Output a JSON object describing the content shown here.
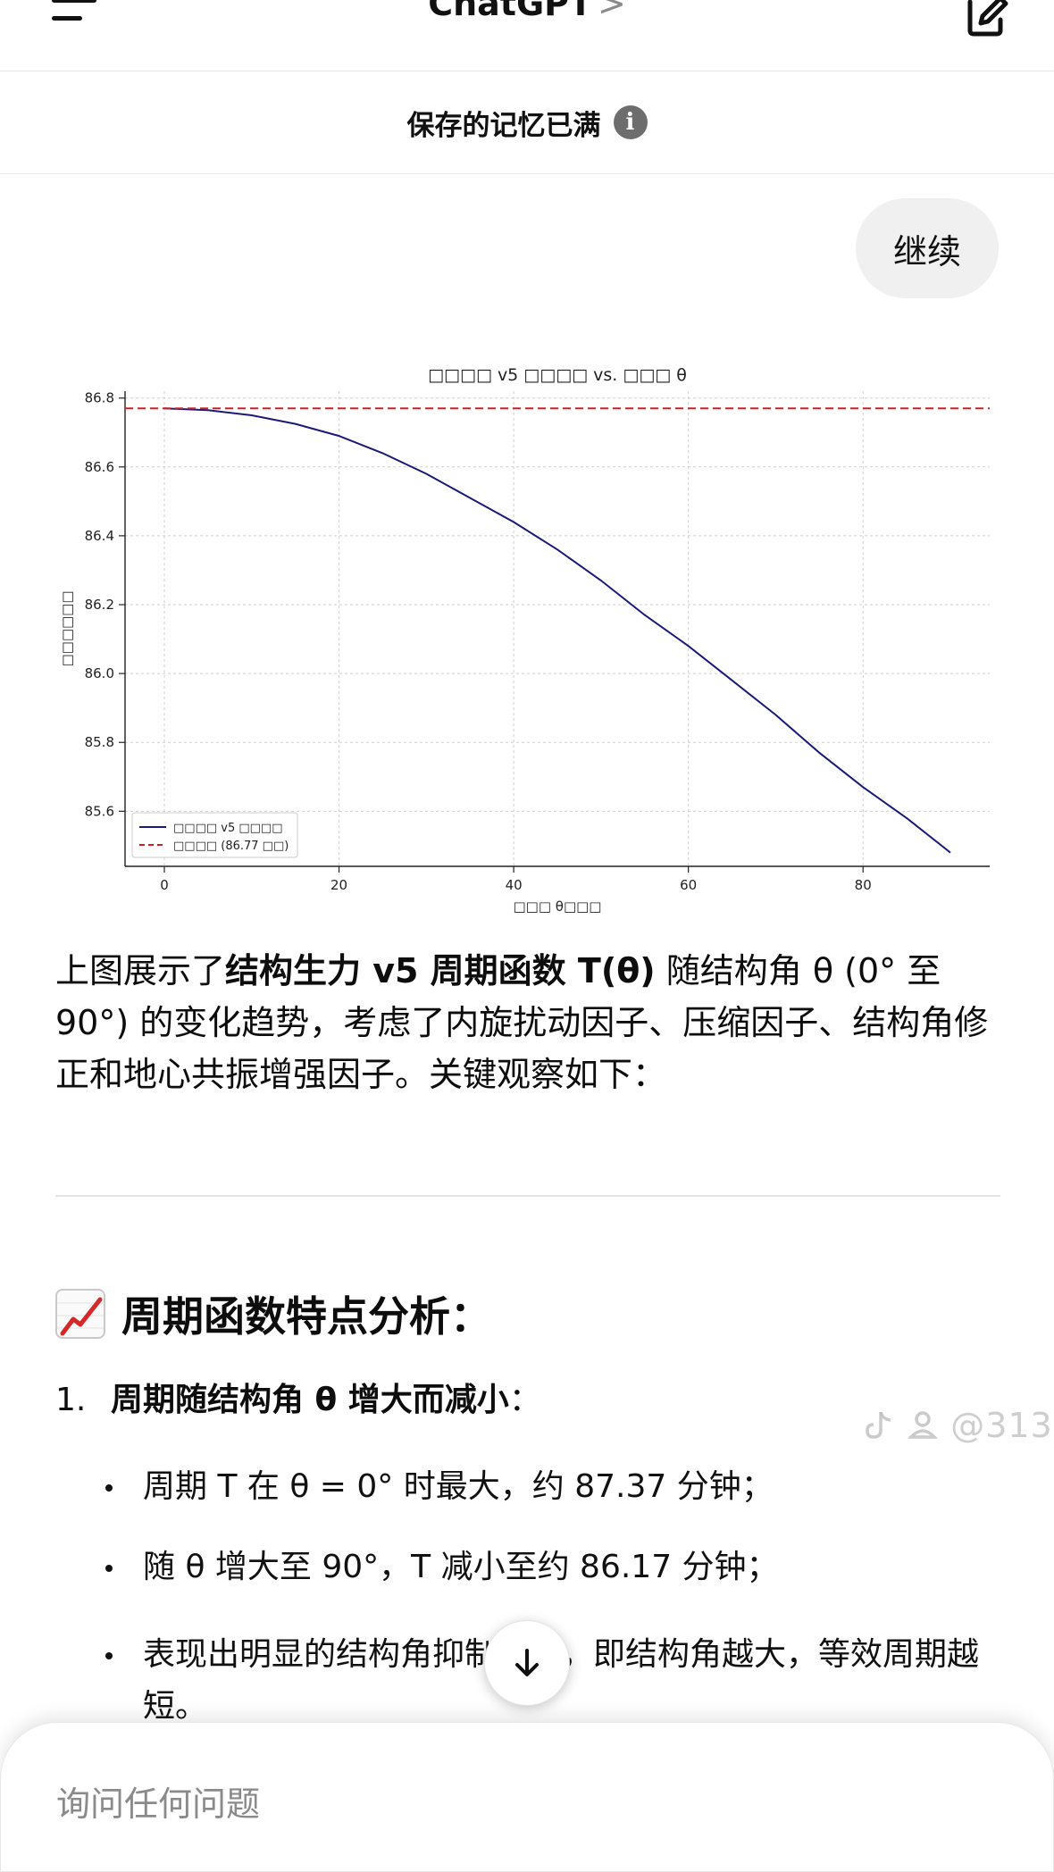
{
  "header": {
    "title": "ChatGPT",
    "title_chevron": ">",
    "menu_icon": "hamburger-icon",
    "compose_icon": "compose-icon"
  },
  "memory_banner": {
    "text": "保存的记忆已满",
    "icon": "info-icon",
    "icon_glyph": "i"
  },
  "user_message": {
    "text": "继续"
  },
  "chart_data": {
    "type": "line",
    "title": "□□□□ v5 □□□□ vs. □□□ θ",
    "xlabel": "□□□ θ□□□",
    "ylabel": "□□□□□□",
    "xlim": [
      -4.5,
      94.5
    ],
    "ylim": [
      85.44,
      86.82
    ],
    "xticks": [
      0,
      20,
      40,
      60,
      80
    ],
    "yticks": [
      85.6,
      85.8,
      86.0,
      86.2,
      86.4,
      86.6,
      86.8
    ],
    "xtick_labels": [
      "0",
      "20",
      "40",
      "60",
      "80"
    ],
    "ytick_labels": [
      "85.6",
      "85.8",
      "86.0",
      "86.2",
      "86.4",
      "86.6",
      "86.8"
    ],
    "grid": true,
    "legend_position": "lower-left",
    "series": [
      {
        "name": "□□□□ v5 □□□□",
        "style": "solid",
        "color": "#1a1a7a",
        "x": [
          0,
          5,
          10,
          15,
          20,
          25,
          30,
          35,
          40,
          45,
          50,
          55,
          60,
          65,
          70,
          75,
          80,
          85,
          90
        ],
        "y": [
          86.77,
          86.765,
          86.75,
          86.725,
          86.69,
          86.64,
          86.58,
          86.51,
          86.44,
          86.36,
          86.27,
          86.17,
          86.08,
          85.98,
          85.88,
          85.77,
          85.67,
          85.58,
          85.48
        ]
      },
      {
        "name": "□□□□ (86.77 □□)",
        "style": "dashed",
        "color": "#cc2222",
        "x": [
          -4.5,
          94.5
        ],
        "y": [
          86.77,
          86.77
        ]
      }
    ]
  },
  "summary": {
    "p1": "上图展示了",
    "bold1": "结构生力 v5 周期函数 T(θ)",
    "p2": " 随结构角 θ (0° 至 90°) 的变化趋势，考虑了内旋扰动因子、压缩因子、结构角修正和地心共振增强因子。关键观察如下："
  },
  "section": {
    "title": "周期函数特点分析：",
    "icon": "chart-increasing-icon"
  },
  "list": {
    "item1_num": "1.",
    "item1_bold": "周期随结构角 θ 增大而减小",
    "item1_tail": "：",
    "bullets": [
      "周期 T 在 θ = 0° 时最大，约 87.37 分钟；",
      "随 θ 增大至 90°，T 减小至约 86.17 分钟；",
      "表现出明显的结构角抑制效应，即结构角越大，等效周期越短。"
    ]
  },
  "watermark": {
    "text": "@313"
  },
  "scroll_button": {
    "icon": "arrow-down-icon"
  },
  "composer": {
    "placeholder": "询问任何问题"
  }
}
